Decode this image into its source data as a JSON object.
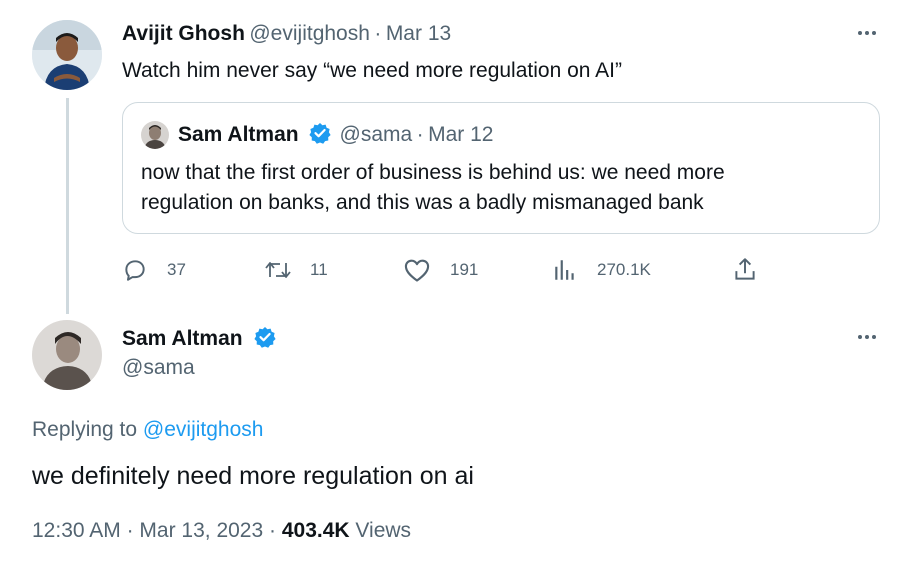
{
  "parent_tweet": {
    "author_name": "Avijit Ghosh",
    "author_handle": "@evijitghosh",
    "separator": "·",
    "date": "Mar 13",
    "text": "Watch him never say “we need more regulation on AI”",
    "quoted": {
      "author_name": "Sam Altman",
      "author_handle": "@sama",
      "separator": "·",
      "date": "Mar 12",
      "text_line1": "now that the first order of business is behind us: we need more",
      "text_line2": "regulation on banks, and this was a badly mismanaged bank"
    },
    "metrics": {
      "replies": "37",
      "retweets": "11",
      "likes": "191",
      "views": "270.1K"
    }
  },
  "main_tweet": {
    "author_name": "Sam Altman",
    "author_handle": "@sama",
    "replying_prefix": "Replying to",
    "replying_to": "@evijitghosh",
    "text": "we definitely need more regulation on ai",
    "time": "12:30 AM",
    "separator": "·",
    "date": "Mar 13, 2023",
    "separator2": "·",
    "views_count": "403.4K",
    "views_label": "Views"
  },
  "icons": {
    "more": "more-icon",
    "reply": "reply-icon",
    "retweet": "retweet-icon",
    "like": "heart-icon",
    "views": "views-icon",
    "share": "share-icon",
    "verified": "verified-badge-icon"
  },
  "colors": {
    "accent": "#1d9bf0",
    "text": "#0f1419",
    "muted": "#536471",
    "border": "#cfd9de"
  }
}
